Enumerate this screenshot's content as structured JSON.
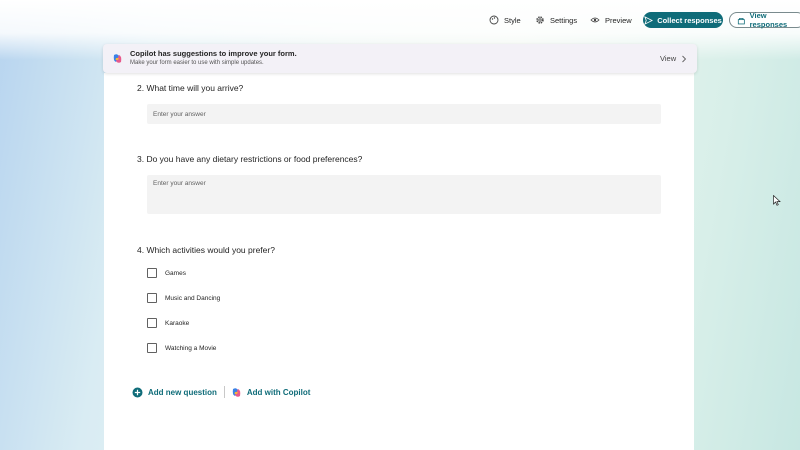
{
  "toolbar": {
    "style": "Style",
    "settings": "Settings",
    "preview": "Preview",
    "collect": "Collect responses",
    "view_responses": "View responses"
  },
  "banner": {
    "title": "Copilot has suggestions to improve your form.",
    "subtitle": "Make your form easier to use with simple updates.",
    "view": "View"
  },
  "questions": [
    {
      "label": "2. What time will you arrive?",
      "placeholder": "Enter your answer"
    },
    {
      "label": "3. Do you have any dietary restrictions or food preferences?",
      "placeholder": "Enter your answer"
    },
    {
      "label": "4. Which activities would you prefer?",
      "options": [
        "Games",
        "Music and Dancing",
        "Karaoke",
        "Watching a Movie"
      ]
    }
  ],
  "actions": {
    "add_question": "Add new question",
    "add_copilot": "Add with Copilot"
  },
  "colors": {
    "accent": "#0f6c79"
  }
}
